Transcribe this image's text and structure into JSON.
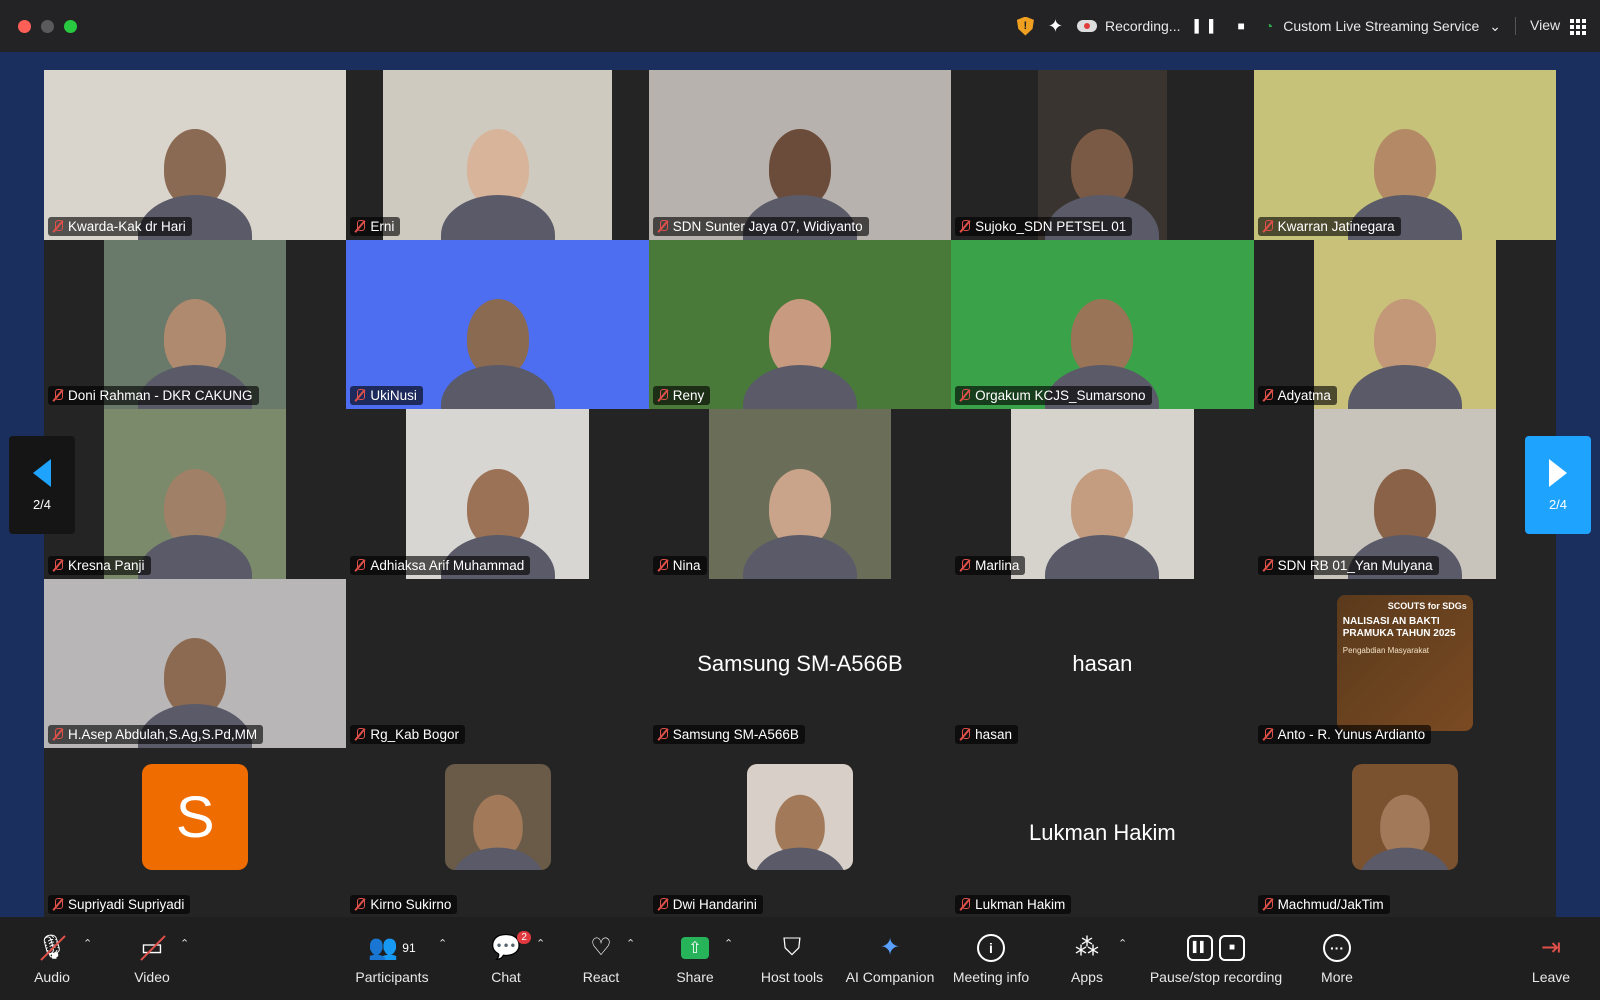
{
  "titlebar": {
    "recording_label": "Recording...",
    "live_label": "Custom Live Streaming Service",
    "view_label": "View"
  },
  "pagination": {
    "left": "2/4",
    "right": "2/4"
  },
  "tiles": [
    {
      "name": "Kwarda-Kak dr Hari",
      "bg": "#d9d4cc",
      "face": "#8a6a52"
    },
    {
      "name": "Erni",
      "bg": "#cfcac0",
      "face": "#d8b49a"
    },
    {
      "name": "SDN Sunter Jaya 07, Widiyanto",
      "bg": "#b8b2ae",
      "face": "#6b4c3a"
    },
    {
      "name": "Sujoko_SDN PETSEL 01",
      "bg": "#3a3430",
      "face": "#7a5a44"
    },
    {
      "name": "Kwarran Jatinegara",
      "bg": "#c7c27a",
      "face": "#b48a66"
    },
    {
      "name": "Doni Rahman - DKR CAKUNG",
      "bg": "#6a7a6a",
      "face": "#b08a6e"
    },
    {
      "name": "UkiNusi",
      "bg": "#4d6ef0",
      "face": "#8a6a50"
    },
    {
      "name": "Reny",
      "bg": "#4a7a3a",
      "face": "#c89a80"
    },
    {
      "name": "Orgakum KCJS_Sumarsono",
      "bg": "#3aa34a",
      "face": "#9a7456"
    },
    {
      "name": "Adyatma",
      "bg": "#c9c07a",
      "face": "#c29878"
    },
    {
      "name": "Kresna Panji",
      "bg": "#7a8a6a",
      "face": "#a08066"
    },
    {
      "name": "Adhiaksa Arif Muhammad",
      "bg": "#d8d6d2",
      "face": "#9c7256"
    },
    {
      "name": "Nina",
      "bg": "#6a6e58",
      "face": "#caa48a"
    },
    {
      "name": "Marlina",
      "bg": "#d6d2cc",
      "face": "#c49c80"
    },
    {
      "name": "SDN RB 01_Yan Mulyana",
      "bg": "#c8c4bc",
      "face": "#8a6248"
    },
    {
      "name": "H.Asep Abdulah,S.Ag,S.Pd,MM",
      "bg": "#b8b6b6",
      "face": "#8c6a52"
    },
    {
      "name": "Rg_Kab Bogor"
    },
    {
      "name": "Samsung SM-A566B",
      "center": "Samsung SM-A566B"
    },
    {
      "name": "hasan",
      "center": "hasan"
    },
    {
      "name": "Anto - R. Yunus Ardianto",
      "slide": {
        "brand": "SCOUTS for SDGs",
        "title": "NALISASI AN BAKTI PRAMUKA TAHUN 2025",
        "sub": "Pengabdian Masyarakat"
      }
    },
    {
      "name": "Supriyadi Supriyadi",
      "letter": "S"
    },
    {
      "name": "Kirno Sukirno",
      "avatar": "#6a5a48"
    },
    {
      "name": "Dwi Handarini",
      "avatar": "#d8d0c8"
    },
    {
      "name": "Lukman Hakim",
      "center": "Lukman Hakim"
    },
    {
      "name": "Machmud/JakTim",
      "avatar": "#7a5230"
    }
  ],
  "toolbar": {
    "audio": "Audio",
    "video": "Video",
    "participants": "Participants",
    "participants_count": "91",
    "chat": "Chat",
    "chat_badge": "2",
    "react": "React",
    "share": "Share",
    "host_tools": "Host tools",
    "ai_companion": "AI Companion",
    "meeting_info": "Meeting info",
    "apps": "Apps",
    "record": "Pause/stop recording",
    "more": "More",
    "leave": "Leave"
  }
}
